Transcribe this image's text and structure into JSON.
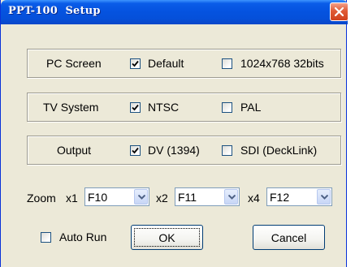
{
  "window": {
    "title": "PPT-100  Setup"
  },
  "pc_screen": {
    "label": "PC Screen",
    "options": [
      {
        "label": "Default",
        "checked": true
      },
      {
        "label": "1024x768 32bits",
        "checked": false
      }
    ]
  },
  "tv_system": {
    "label": "TV System",
    "options": [
      {
        "label": "NTSC",
        "checked": true
      },
      {
        "label": "PAL",
        "checked": false
      }
    ]
  },
  "output": {
    "label": "Output",
    "options": [
      {
        "label": "DV (1394)",
        "checked": true
      },
      {
        "label": "SDI (DeckLink)",
        "checked": false
      }
    ]
  },
  "zoom": {
    "label": "Zoom",
    "x1": {
      "label": "x1",
      "value": "F10"
    },
    "x2": {
      "label": "x2",
      "value": "F11"
    },
    "x4": {
      "label": "x4",
      "value": "F12"
    }
  },
  "auto_run": {
    "label": "Auto Run",
    "checked": false
  },
  "buttons": {
    "ok": "OK",
    "cancel": "Cancel"
  },
  "colors": {
    "titlebar": "#0553e0",
    "close_button": "#e05a35",
    "dialog_background": "#ece9d8",
    "checkbox_border": "#1c5180",
    "check_mark": "#21a121"
  },
  "icons": {
    "close": "close-icon",
    "check": "check-mark-icon",
    "dropdown": "chevron-down-icon"
  }
}
